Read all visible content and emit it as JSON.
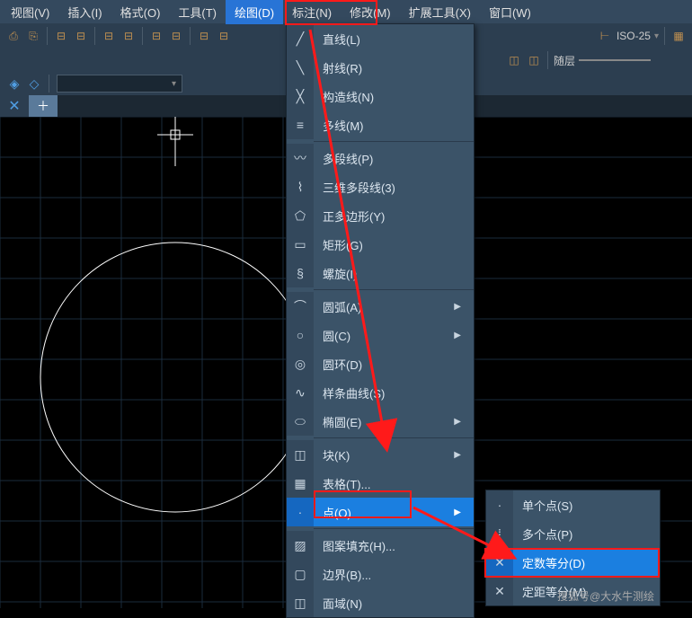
{
  "menubar": {
    "items": [
      {
        "label": "视图(V)"
      },
      {
        "label": "插入(I)"
      },
      {
        "label": "格式(O)"
      },
      {
        "label": "工具(T)"
      },
      {
        "label": "绘图(D)",
        "highlighted": true
      },
      {
        "label": "标注(N)"
      },
      {
        "label": "修改(M)"
      },
      {
        "label": "扩展工具(X)"
      },
      {
        "label": "窗口(W)"
      }
    ]
  },
  "toolbar": {
    "dim_style": "ISO-25",
    "layer_text": "随层"
  },
  "draw_menu": {
    "items": [
      {
        "icon": "line",
        "label": "直线(L)"
      },
      {
        "icon": "ray",
        "label": "射线(R)"
      },
      {
        "icon": "xline",
        "label": "构造线(N)"
      },
      {
        "icon": "mline",
        "label": "多线(M)"
      },
      {
        "sep": true
      },
      {
        "icon": "pline",
        "label": "多段线(P)"
      },
      {
        "icon": "3dpoly",
        "label": "三维多段线(3)"
      },
      {
        "icon": "polygon",
        "label": "正多边形(Y)"
      },
      {
        "icon": "rect",
        "label": "矩形(G)"
      },
      {
        "icon": "helix",
        "label": "螺旋(I)"
      },
      {
        "sep": true
      },
      {
        "icon": "arc",
        "label": "圆弧(A)",
        "submenu": true
      },
      {
        "icon": "circle",
        "label": "圆(C)",
        "submenu": true
      },
      {
        "icon": "donut",
        "label": "圆环(D)"
      },
      {
        "icon": "spline",
        "label": "样条曲线(S)"
      },
      {
        "icon": "ellipse",
        "label": "椭圆(E)",
        "submenu": true
      },
      {
        "sep": true
      },
      {
        "icon": "block",
        "label": "块(K)",
        "submenu": true
      },
      {
        "icon": "table",
        "label": "表格(T)..."
      },
      {
        "icon": "point",
        "label": "点(O)",
        "submenu": true,
        "selected": true
      },
      {
        "sep": true
      },
      {
        "icon": "hatch",
        "label": "图案填充(H)..."
      },
      {
        "icon": "boundary",
        "label": "边界(B)..."
      },
      {
        "icon": "region",
        "label": "面域(N)"
      }
    ]
  },
  "point_submenu": {
    "items": [
      {
        "icon": "pt1",
        "label": "单个点(S)"
      },
      {
        "icon": "ptm",
        "label": "多个点(P)"
      },
      {
        "icon": "divide",
        "label": "定数等分(D)",
        "selected": true
      },
      {
        "icon": "measure",
        "label": "定距等分(M)"
      }
    ]
  },
  "watermark": "搜狐号@大水牛测绘",
  "submenu_measure_visible": "定距"
}
